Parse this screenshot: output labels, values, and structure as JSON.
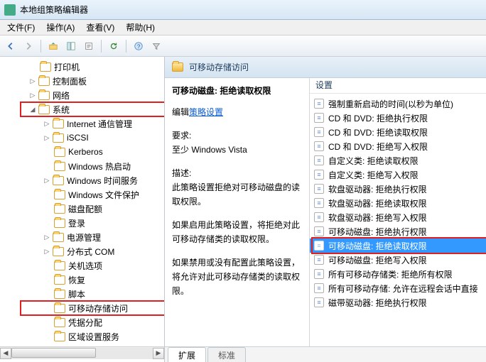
{
  "window": {
    "title": "本地组策略编辑器"
  },
  "menu": {
    "file": "文件(F)",
    "action": "操作(A)",
    "view": "查看(V)",
    "help": "帮助(H)"
  },
  "tree": {
    "n0": "打印机",
    "n1": "控制面板",
    "n2": "网络",
    "n3": "系统",
    "c0": "Internet 通信管理",
    "c1": "iSCSI",
    "c2": "Kerberos",
    "c3": "Windows 热启动",
    "c4": "Windows 时间服务",
    "c5": "Windows 文件保护",
    "c6": "磁盘配额",
    "c7": "登录",
    "c8": "电源管理",
    "c9": "分布式 COM",
    "c10": "关机选项",
    "c11": "恢复",
    "c12": "脚本",
    "c13": "可移动存储访问",
    "c14": "凭据分配",
    "c15": "区域设置服务"
  },
  "header": {
    "title": "可移动存储访问"
  },
  "detail": {
    "title": "可移动磁盘: 拒绝读取权限",
    "edit_prefix": "编辑",
    "edit_link": "策略设置",
    "req_label": "要求:",
    "req_value": "至少 Windows Vista",
    "desc_label": "描述:",
    "desc_value": "此策略设置拒绝对可移动磁盘的读取权限。",
    "p1": "如果启用此策略设置，将拒绝对此可移动存储类的读取权限。",
    "p2": "如果禁用或没有配置此策略设置，将允许对此可移动存储类的读取权限。"
  },
  "list": {
    "header": "设置",
    "i0": "强制重新启动的时间(以秒为单位)",
    "i1": "CD 和 DVD: 拒绝执行权限",
    "i2": "CD 和 DVD: 拒绝读取权限",
    "i3": "CD 和 DVD: 拒绝写入权限",
    "i4": "自定义类: 拒绝读取权限",
    "i5": "自定义类: 拒绝写入权限",
    "i6": "软盘驱动器: 拒绝执行权限",
    "i7": "软盘驱动器: 拒绝读取权限",
    "i8": "软盘驱动器: 拒绝写入权限",
    "i9": "可移动磁盘: 拒绝执行权限",
    "i10": "可移动磁盘: 拒绝读取权限",
    "i11": "可移动磁盘: 拒绝写入权限",
    "i12": "所有可移动存储类: 拒绝所有权限",
    "i13": "所有可移动存储: 允许在远程会话中直接",
    "i14": "磁带驱动器: 拒绝执行权限"
  },
  "tabs": {
    "extended": "扩展",
    "standard": "标准"
  }
}
